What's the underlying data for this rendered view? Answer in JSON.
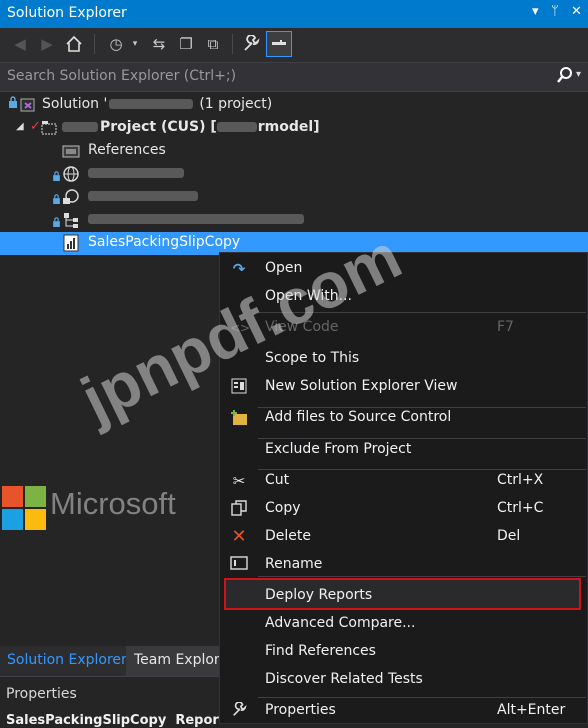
{
  "window": {
    "title": "Solution Explorer",
    "controls": [
      "▾",
      "ᛘ",
      "✕"
    ]
  },
  "search": {
    "placeholder": "Search Solution Explorer (Ctrl+;)"
  },
  "tree": {
    "solution": {
      "prefix": "Solution '",
      "suffix": "(1 project)"
    },
    "project": {
      "label": "Project (CUS) [",
      "suffix": "rmodel]"
    },
    "references": "References",
    "selected_item": "SalesPackingSlipCopy"
  },
  "context_menu": {
    "items": [
      {
        "label": "Open",
        "shortcut": "",
        "icon": "open-icon"
      },
      {
        "label": "Open With...",
        "shortcut": "",
        "icon": ""
      },
      {
        "label": "View Code",
        "shortcut": "F7",
        "icon": "code-icon"
      },
      {
        "label": "Scope to This",
        "shortcut": "",
        "icon": ""
      },
      {
        "label": "New Solution Explorer View",
        "shortcut": "",
        "icon": "new-view-icon"
      },
      {
        "label": "Add files to Source Control",
        "shortcut": "",
        "icon": "source-control-icon"
      },
      {
        "label": "Exclude From Project",
        "shortcut": "",
        "icon": ""
      },
      {
        "label": "Cut",
        "shortcut": "Ctrl+X",
        "icon": "cut-icon"
      },
      {
        "label": "Copy",
        "shortcut": "Ctrl+C",
        "icon": "copy-icon"
      },
      {
        "label": "Delete",
        "shortcut": "Del",
        "icon": "delete-icon"
      },
      {
        "label": "Rename",
        "shortcut": "",
        "icon": "rename-icon"
      },
      {
        "label": "Deploy Reports",
        "shortcut": "",
        "icon": ""
      },
      {
        "label": "Advanced Compare...",
        "shortcut": "",
        "icon": ""
      },
      {
        "label": "Find References",
        "shortcut": "",
        "icon": ""
      },
      {
        "label": "Discover Related Tests",
        "shortcut": "",
        "icon": ""
      },
      {
        "label": "Properties",
        "shortcut": "Alt+Enter",
        "icon": "wrench-icon"
      }
    ]
  },
  "bottom_tabs": {
    "solution_explorer": "Solution Explorer",
    "team_explorer": "Team Explore"
  },
  "properties": {
    "title": "Properties",
    "row": "SalesPackingSlipCopy  Report F"
  },
  "watermark": {
    "text": "jpnpdf.com",
    "microsoft": "Microsoft"
  },
  "colors": {
    "accent": "#007acc",
    "selection": "#3399ff",
    "highlight_border": "#d0121b"
  }
}
